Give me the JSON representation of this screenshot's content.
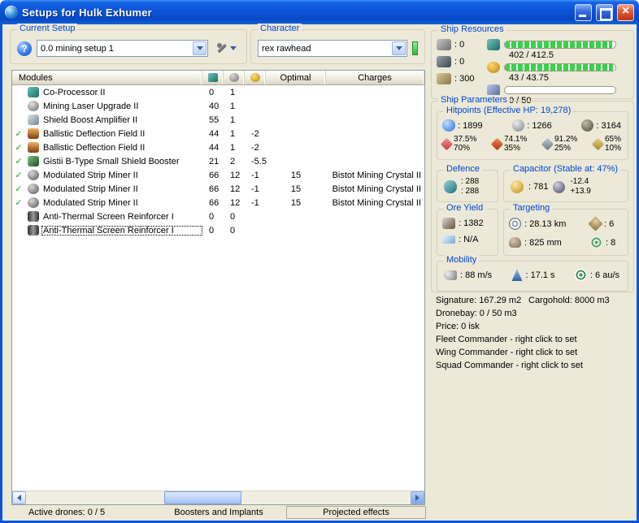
{
  "window": {
    "title": "Setups for Hulk Exhumer"
  },
  "colors": {
    "titlebar_blue": "#0b54d8",
    "window_background": "#ece9d8",
    "group_label_blue": "#0046d5",
    "fitted_check_green": "#1fa11f",
    "resource_bar_green": "#3ecf4e",
    "character_status_green": "#3fd04a",
    "close_button_red": "#d8502e"
  },
  "icons": {
    "app-icon": "blue-orb",
    "minimize-icon": "underscore",
    "maximize-icon": "square",
    "close-icon": "×",
    "help-icon": "?",
    "tools-icon": "wrench",
    "combo-arrow-icon": "▼",
    "scroll-left-icon": "◄",
    "scroll-right-icon": "►",
    "fitted-check-icon": "✓",
    "cpu-column-icon": "cpu-chip",
    "powergrid-column-icon": "powergrid",
    "capacitor-column-icon": "capacitor",
    "turret-hardpoints-icon": "turret",
    "launcher-hardpoints-icon": "launcher",
    "calibration-icon": "calibration",
    "cpu-icon": "cpu-chip",
    "powergrid-icon": "powergrid-coil",
    "drone-bandwidth-icon": "drone",
    "shield-hp-icon": "shield",
    "armor-hp-icon": "armor-plate",
    "hull-hp-icon": "hull-gear",
    "em-resist-icon": "em",
    "thermal-resist-icon": "thermal",
    "kinetic-resist-icon": "kinetic",
    "explosive-resist-icon": "explosive",
    "defence-icon": "shield-regen",
    "capacitor-icon": "capacitor-dial",
    "cap-recharge-icon": "recharge",
    "ore-yield-icon": "mining-laser",
    "ice-yield-icon": "ice-harvester",
    "targeting-range-icon": "crosshair",
    "max-targets-icon": "compass",
    "scan-resolution-icon": "radar-dish",
    "sensor-strength-icon": "sensor-rings",
    "speed-icon": "afterburner",
    "align-time-icon": "rocket",
    "warp-speed-icon": "warp-spiral"
  },
  "current_setup": {
    "label": "Current Setup",
    "value": "0.0 mining setup 1"
  },
  "character": {
    "label": "Character",
    "value": "rex rawhead"
  },
  "modules": {
    "columns": {
      "name": "Modules",
      "optimal": "Optimal",
      "charges": "Charges"
    },
    "rows": [
      {
        "check": "",
        "icon": "chip",
        "name": "Co-Processor II",
        "cpu": "0",
        "pg": "1",
        "cap": "",
        "optimal": "",
        "charges": ""
      },
      {
        "check": "",
        "icon": "sphere",
        "name": "Mining Laser Upgrade II",
        "cpu": "40",
        "pg": "1",
        "cap": "",
        "optimal": "",
        "charges": ""
      },
      {
        "check": "",
        "icon": "amp",
        "name": "Shield Boost Amplifier II",
        "cpu": "55",
        "pg": "1",
        "cap": "",
        "optimal": "",
        "charges": ""
      },
      {
        "check": "✓",
        "icon": "field",
        "name": "Ballistic Deflection Field II",
        "cpu": "44",
        "pg": "1",
        "cap": "-2",
        "optimal": "",
        "charges": ""
      },
      {
        "check": "✓",
        "icon": "field",
        "name": "Ballistic Deflection Field II",
        "cpu": "44",
        "pg": "1",
        "cap": "-2",
        "optimal": "",
        "charges": ""
      },
      {
        "check": "✓",
        "icon": "booster",
        "name": "Gistii B-Type Small Shield Booster",
        "cpu": "21",
        "pg": "2",
        "cap": "-5.5",
        "optimal": "",
        "charges": ""
      },
      {
        "check": "✓",
        "icon": "miner",
        "name": "Modulated Strip Miner II",
        "cpu": "66",
        "pg": "12",
        "cap": "-1",
        "optimal": "15",
        "charges": "Bistot Mining Crystal II"
      },
      {
        "check": "✓",
        "icon": "miner",
        "name": "Modulated Strip Miner II",
        "cpu": "66",
        "pg": "12",
        "cap": "-1",
        "optimal": "15",
        "charges": "Bistot Mining Crystal II"
      },
      {
        "check": "✓",
        "icon": "miner",
        "name": "Modulated Strip Miner II",
        "cpu": "66",
        "pg": "12",
        "cap": "-1",
        "optimal": "15",
        "charges": "Bistot Mining Crystal II"
      },
      {
        "check": "",
        "icon": "rig",
        "name": "Anti-Thermal Screen Reinforcer I",
        "cpu": "0",
        "pg": "0",
        "cap": "",
        "optimal": "",
        "charges": ""
      },
      {
        "check": "",
        "icon": "rig",
        "name": "Anti-Thermal Screen Reinforcer I",
        "cpu": "0",
        "pg": "0",
        "cap": "",
        "optimal": "",
        "charges": ""
      }
    ]
  },
  "ship_resources": {
    "label": "Ship Resources",
    "turret_hardpoints": ": 0",
    "launcher_hardpoints": ": 0",
    "calibration": ": 300",
    "cpu": {
      "used_total": "402 / 412.5",
      "percent": 97
    },
    "powergrid": {
      "used_total": "43 / 43.75",
      "percent": 98
    },
    "drone_bandwidth": {
      "used_total": "0 / 50",
      "percent": 0
    }
  },
  "ship_parameters": {
    "label": "Ship Parameters",
    "hitpoints": {
      "label": "Hitpoints (Effective HP: 19,278)",
      "shield": ": 1899",
      "armor": ": 1266",
      "hull": ": 3164",
      "resists": [
        {
          "shield": "37.5%",
          "armor": "70%"
        },
        {
          "shield": "74.1%",
          "armor": "35%"
        },
        {
          "shield": "91.2%",
          "armor": "25%"
        },
        {
          "shield": "65%",
          "armor": "10%"
        }
      ]
    },
    "defence": {
      "label": "Defence",
      "value1": ": 288",
      "value2": ": 288"
    },
    "capacitor": {
      "label": "Capacitor (Stable at: 47%)",
      "amount": ": 781",
      "peak_drain": "-12.4",
      "recharge": "+13.9"
    },
    "ore_yield": {
      "label": "Ore Yield",
      "ore": ": 1382",
      "ice": ": N/A"
    },
    "targeting": {
      "label": "Targeting",
      "range": ": 28.13 km",
      "max_targets": ": 6",
      "scan_resolution": ": 825 mm",
      "sensor_strength": ": 8"
    },
    "mobility": {
      "label": "Mobility",
      "speed": ": 88 m/s",
      "align_time": ": 17.1 s",
      "warp_speed": ": 6 au/s"
    }
  },
  "summary": {
    "signature": "Signature: 167.29 m2",
    "cargohold": "Cargohold: 8000 m3",
    "dronebay": "Dronebay: 0 / 50 m3",
    "price": "Price: 0 isk",
    "fleet_commander": "Fleet Commander - right click to set",
    "wing_commander": "Wing Commander - right click to set",
    "squad_commander": "Squad Commander - right click to set"
  },
  "footer": {
    "active_drones": "Active drones: 0 / 5",
    "boosters_implants": "Boosters and Implants",
    "projected_effects": "Projected effects"
  }
}
